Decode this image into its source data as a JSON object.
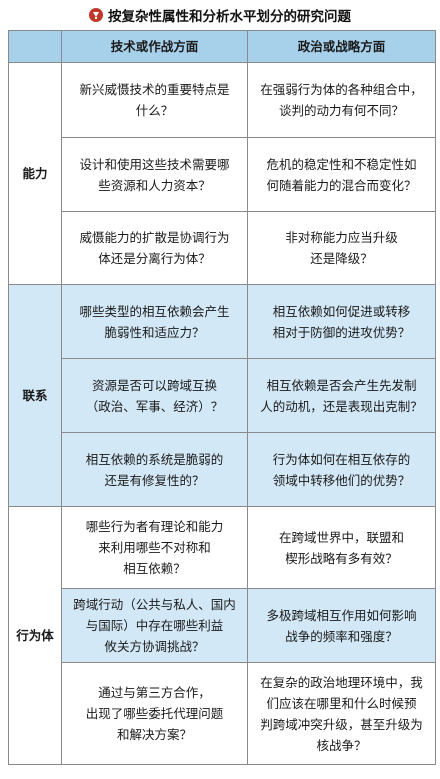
{
  "title": "按复杂性属性和分析水平划分的研究问题",
  "header": {
    "corner": "",
    "col_tech": "技术或作战方面",
    "col_pol": "政治或战略方面"
  },
  "groups": {
    "ability": {
      "label": "能力",
      "rows": [
        {
          "tech": "新兴威慑技术的重要特点是\n什么？",
          "pol": "在强弱行为体的各种组合中，\n谈判的动力有何不同？"
        },
        {
          "tech": "设计和使用这些技术需要哪\n些资源和人力资本？",
          "pol": "危机的稳定性和不稳定性如\n何随着能力的混合而变化？"
        },
        {
          "tech": "威慑能力的扩散是协调行为\n体还是分离行为体？",
          "pol": "非对称能力应当升级\n还是降级？"
        }
      ]
    },
    "link": {
      "label": "联系",
      "rows": [
        {
          "tech": "哪些类型的相互依赖会产生\n脆弱性和适应力？",
          "pol": "相互依赖如何促进或转移\n相对于防御的进攻优势？"
        },
        {
          "tech": "资源是否可以跨域互换\n（政治、军事、经济）？",
          "pol": "相互依赖是否会产生先发制\n人的动机，还是表现出克制？"
        },
        {
          "tech": "相互依赖的系统是脆弱的\n还是有修复性的？",
          "pol": "行为体如何在相互依存的\n领域中转移他们的优势？"
        }
      ]
    },
    "actor": {
      "label": "行为体",
      "rows": [
        {
          "tech": "哪些行为者有理论和能力\n来利用哪些不对称和\n相互依赖？",
          "pol": "在跨域世界中，联盟和\n楔形战略有多有效？"
        },
        {
          "tech": "跨域行动（公共与私人、国内\n与国际）中存在哪些利益\n攸关方协调挑战？",
          "pol": "多极跨域相互作用如何影响\n战争的频率和强度？"
        },
        {
          "tech": "通过与第三方合作，\n出现了哪些委托代理问题\n和解决方案？",
          "pol": "在复杂的政治地理环境中，我\n们应该在哪里和什么时候预\n判跨域冲突升级，甚至升级为\n核战争？"
        }
      ]
    }
  },
  "colors": {
    "header_bg": "#a7d1ea",
    "shade_bg": "#d3e8f6",
    "border": "#8a8a8a",
    "icon": "#c0392b"
  },
  "icons": {
    "title_icon": "down-arrow-circle-icon"
  }
}
